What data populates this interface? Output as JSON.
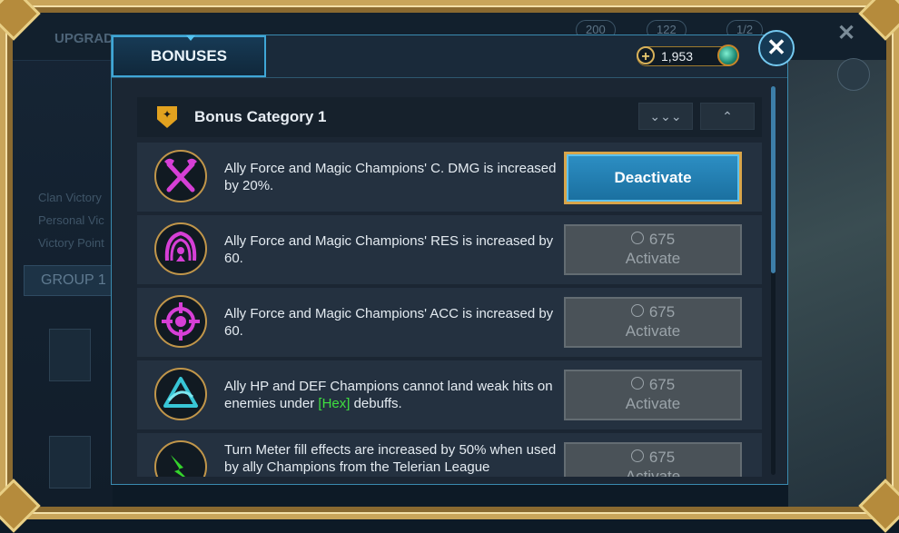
{
  "background": {
    "upgrade_label": "UPGRAD",
    "side_labels": [
      "Clan Victory",
      "Personal Vic",
      "Victory Point"
    ],
    "group_label": "GROUP 1",
    "top_pills": [
      "200",
      "122",
      "1/2"
    ]
  },
  "modal": {
    "tab_label": "BONUSES",
    "currency_value": "1,953",
    "close_icon": "close-icon"
  },
  "category": {
    "title": "Bonus Category 1",
    "expand_icon": "chevrons-down-icon",
    "collapse_icon": "chevron-up-icon"
  },
  "bonuses": [
    {
      "icon": "crossed-axes-icon",
      "icon_color": "#d63fd6",
      "text": "Ally Force and Magic Champions' C. DMG is increased by 20%.",
      "button": "Deactivate"
    },
    {
      "icon": "shield-figure-icon",
      "icon_color": "#d63fd6",
      "text": "Ally Force and Magic Champions' RES is increased by 60.",
      "cost": "675",
      "button": "Activate"
    },
    {
      "icon": "crosshair-icon",
      "icon_color": "#d63fd6",
      "text": "Ally Force and Magic Champions' ACC is increased by 60.",
      "cost": "675",
      "button": "Activate"
    },
    {
      "icon": "triangle-swirl-icon",
      "icon_color": "#38c6d6",
      "text_before": "Ally HP and DEF Champions cannot land weak hits on enemies under ",
      "text_highlight": "[Hex]",
      "text_after": " debuffs.",
      "cost": "675",
      "button": "Activate"
    },
    {
      "icon": "lightning-icon",
      "icon_color": "#35d42c",
      "text": "Turn Meter fill effects are increased by 50% when used by ally Champions from the Telerian League",
      "cost": "675",
      "button": "Activate"
    }
  ]
}
